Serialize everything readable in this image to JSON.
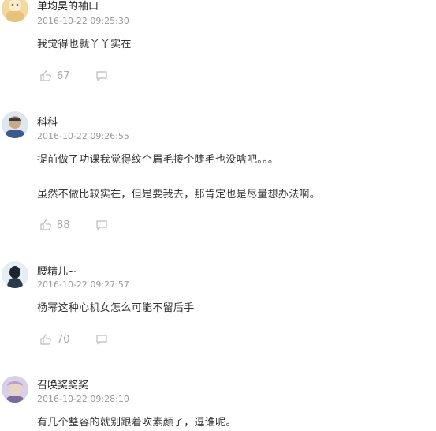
{
  "comments": [
    {
      "user": "单均昊的袖口",
      "time": "2016-10-22 09:25:30",
      "lines": [
        "我觉得也就丫丫实在"
      ],
      "likes": "67"
    },
    {
      "user": "科科",
      "time": "2016-10-22 09:26:55",
      "lines": [
        "提前做了功课我觉得纹个眉毛接个睫毛也没啥吧。。。",
        "虽然不做比较实在，但是要我去，那肯定也是尽量想办法啊。"
      ],
      "likes": "88"
    },
    {
      "user": "腰精儿~",
      "time": "2016-10-22 09:27:57",
      "lines": [
        "杨幂这种心机女怎么可能不留后手"
      ],
      "likes": "70"
    },
    {
      "user": "召唤奖奖奖",
      "time": "2016-10-22 09:28:10",
      "lines": [
        "有几个整容的就别跟着吹素颜了，逗谁呢。"
      ],
      "likes": ""
    }
  ],
  "icons": {
    "like": "thumbs-up-icon",
    "reply": "comment-bubble-icon"
  },
  "colors": {
    "meta": "#999999",
    "icon": "#bbbbbb",
    "text": "#333333"
  }
}
